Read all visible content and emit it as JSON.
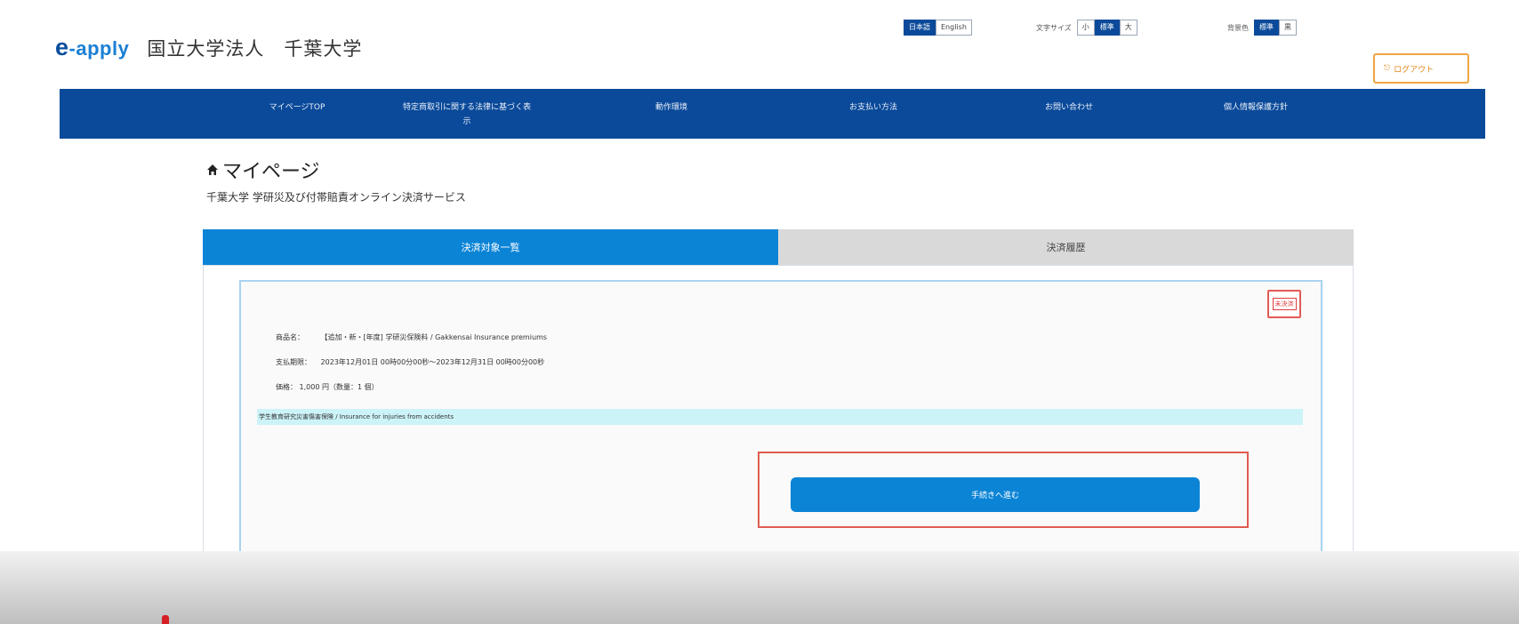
{
  "brand": {
    "logo_prefix": "e",
    "logo_suffix": "-apply",
    "university": "国立大学法人　千葉大学"
  },
  "header": {
    "language": {
      "options": [
        "日本語",
        "English"
      ],
      "selected": "日本語"
    },
    "font_size": {
      "label": "文字サイズ",
      "options": [
        "小",
        "標準",
        "大"
      ],
      "selected": "標準"
    },
    "color": {
      "label": "背景色",
      "options": [
        "標準",
        "黒"
      ],
      "selected": "標準"
    },
    "logout_label": "ログアウト"
  },
  "nav": {
    "items": [
      {
        "label": "マイページTOP"
      },
      {
        "label": "特定商取引に関する法律に基づく表示"
      },
      {
        "label": "動作環境"
      },
      {
        "label": "お支払い方法"
      },
      {
        "label": "お問い合わせ"
      },
      {
        "label": "個人情報保護方針"
      }
    ]
  },
  "page": {
    "title": "マイページ",
    "subtitle": "千葉大学 学研災及び付帯賠責オンライン決済サービス"
  },
  "tabs": [
    {
      "label": "決済対象一覧"
    },
    {
      "label": "決済履歴"
    }
  ],
  "item": {
    "badge": "未決済",
    "product_label": "商品名：",
    "product_value": "【追加・新・[年度] 学研災保険料 / Gakkensai Insurance premiums",
    "period_label": "支払期限：",
    "period_value": "2023年12月01日 00時00分00秒～2023年12月31日 00時00分00秒",
    "price_label": "価格：",
    "price_value": "1,000 円（数量：1 個）",
    "note": "学生教育研究災害傷害保険 / Insurance for injuries from accidents"
  },
  "actions": {
    "apply_label": "手続きへ進む"
  },
  "colors": {
    "nav": "#0b4a9a",
    "accent": "#0b84d6",
    "highlight": "#e05c50"
  }
}
